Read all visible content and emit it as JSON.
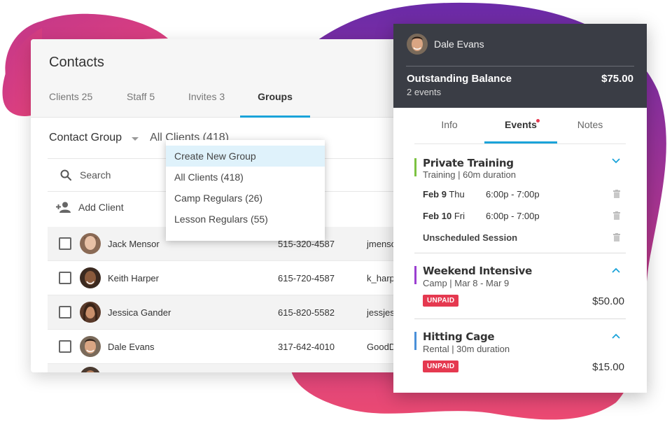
{
  "colors": {
    "accent": "#1aa3d9",
    "unpaid_badge": "#e53950",
    "header_dark": "#3a3d45",
    "blob_pink": "#e8437a",
    "blob_purple": "#7a2ba6"
  },
  "contacts": {
    "title": "Contacts",
    "tabs": [
      {
        "label": "Clients 25"
      },
      {
        "label": "Staff 5"
      },
      {
        "label": "Invites 3"
      },
      {
        "label": "Groups",
        "active": true
      }
    ],
    "group_label": "Contact Group",
    "group_value": "All Clients (418)",
    "search_placeholder": "Search",
    "add_client_label": "Add Client",
    "rows": [
      {
        "name": "Jack Mensor",
        "phone": "515-320-4587",
        "email": "jmenso"
      },
      {
        "name": "Keith Harper",
        "phone": "615-720-4587",
        "email": "k_harp"
      },
      {
        "name": "Jessica Gander",
        "phone": "615-820-5582",
        "email": "jessjes"
      },
      {
        "name": "Dale Evans",
        "phone": "317-642-4010",
        "email": "GoodD"
      }
    ]
  },
  "dropdown": {
    "items": [
      {
        "label": "Create New Group",
        "active": true
      },
      {
        "label": "All Clients (418)"
      },
      {
        "label": "Camp Regulars (26)"
      },
      {
        "label": "Lesson Regulars (55)"
      }
    ]
  },
  "detail": {
    "name": "Dale Evans",
    "balance_label": "Outstanding Balance",
    "balance_amount": "$75.00",
    "events_count": "2 events",
    "tabs": [
      {
        "label": "Info"
      },
      {
        "label": "Events",
        "active": true,
        "notification_dot": true
      },
      {
        "label": "Notes"
      }
    ],
    "events": [
      {
        "title": "Private Training",
        "subtitle": "Training | 60m duration",
        "bar_color": "#7cc242",
        "expanded": true,
        "sessions": [
          {
            "date": "Feb 9",
            "day": "Thu",
            "time": "6:00p - 7:00p"
          },
          {
            "date": "Feb 10",
            "day": "Fri",
            "time": "6:00p - 7:00p"
          },
          {
            "label": "Unscheduled Session"
          }
        ]
      },
      {
        "title": "Weekend Intensive",
        "subtitle": "Camp | Mar 8 - Mar 9",
        "bar_color": "#9b3fd1",
        "badge": "UNPAID",
        "price": "$50.00"
      },
      {
        "title": "Hitting Cage",
        "subtitle": "Rental | 30m duration",
        "bar_color": "#4a90d9",
        "badge": "UNPAID",
        "price": "$15.00"
      }
    ]
  }
}
